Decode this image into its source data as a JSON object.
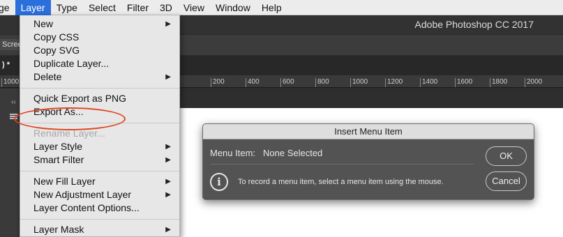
{
  "menubar": {
    "items": [
      "ge",
      "Layer",
      "Type",
      "Select",
      "Filter",
      "3D",
      "View",
      "Window",
      "Help"
    ],
    "active_index": 1
  },
  "app": {
    "title": "Adobe Photoshop CC 2017",
    "screen_button": "Screen",
    "doc_tab": " ) *"
  },
  "ruler": {
    "ticks": [
      "1000",
      "200",
      "400",
      "600",
      "800",
      "1000",
      "1200",
      "1400",
      "1600",
      "1800",
      "2000"
    ]
  },
  "layer_menu": {
    "items": [
      {
        "label": "New",
        "submenu": true,
        "disabled": false
      },
      {
        "label": "Copy CSS",
        "submenu": false,
        "disabled": false
      },
      {
        "label": "Copy SVG",
        "submenu": false,
        "disabled": false
      },
      {
        "label": "Duplicate Layer...",
        "submenu": false,
        "disabled": false
      },
      {
        "label": "Delete",
        "submenu": true,
        "disabled": false
      },
      {
        "label": "Quick Export as PNG",
        "submenu": false,
        "disabled": false
      },
      {
        "label": "Export As...",
        "submenu": false,
        "disabled": false
      },
      {
        "label": "Rename Layer...",
        "submenu": false,
        "disabled": true
      },
      {
        "label": "Layer Style",
        "submenu": true,
        "disabled": false
      },
      {
        "label": "Smart Filter",
        "submenu": true,
        "disabled": false
      },
      {
        "label": "New Fill Layer",
        "submenu": true,
        "disabled": false
      },
      {
        "label": "New Adjustment Layer",
        "submenu": true,
        "disabled": false
      },
      {
        "label": "Layer Content Options...",
        "submenu": false,
        "disabled": false
      },
      {
        "label": "Layer Mask",
        "submenu": true,
        "disabled": false
      }
    ],
    "submenu_arrow": "▶",
    "highlight_color": "#e0451f"
  },
  "dialog": {
    "title": "Insert Menu Item",
    "menu_item_label": "Menu Item:",
    "menu_item_value": "None Selected",
    "hint": "To record a menu item, select a menu item using the mouse.",
    "info_glyph": "i",
    "ok_label": "OK",
    "cancel_label": "Cancel"
  },
  "colors": {
    "menubar_active": "#2a6fdc",
    "workspace": "#2e2e2e",
    "dialog_bg": "#535353"
  }
}
